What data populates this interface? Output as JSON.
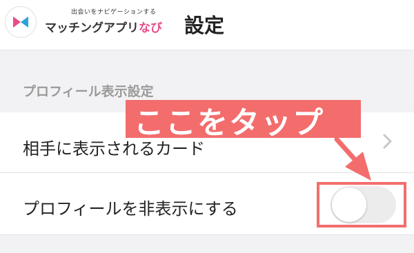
{
  "header": {
    "logo_tagline": "出会いをナビゲーションする",
    "logo_text_main": "マッチングアプリ",
    "logo_text_accent": "なび",
    "title": "設定"
  },
  "section": {
    "label": "プロフィール表示設定"
  },
  "rows": {
    "card_label": "相手に表示されるカード",
    "hide_label": "プロフィールを非表示にする"
  },
  "toggle": {
    "state": "off"
  },
  "annotation": {
    "callout_text": "ここをタップ"
  },
  "colors": {
    "accent_pink": "#e84a8a",
    "annotation_red": "#f36d6d",
    "logo_blue": "#2aa3dc"
  }
}
